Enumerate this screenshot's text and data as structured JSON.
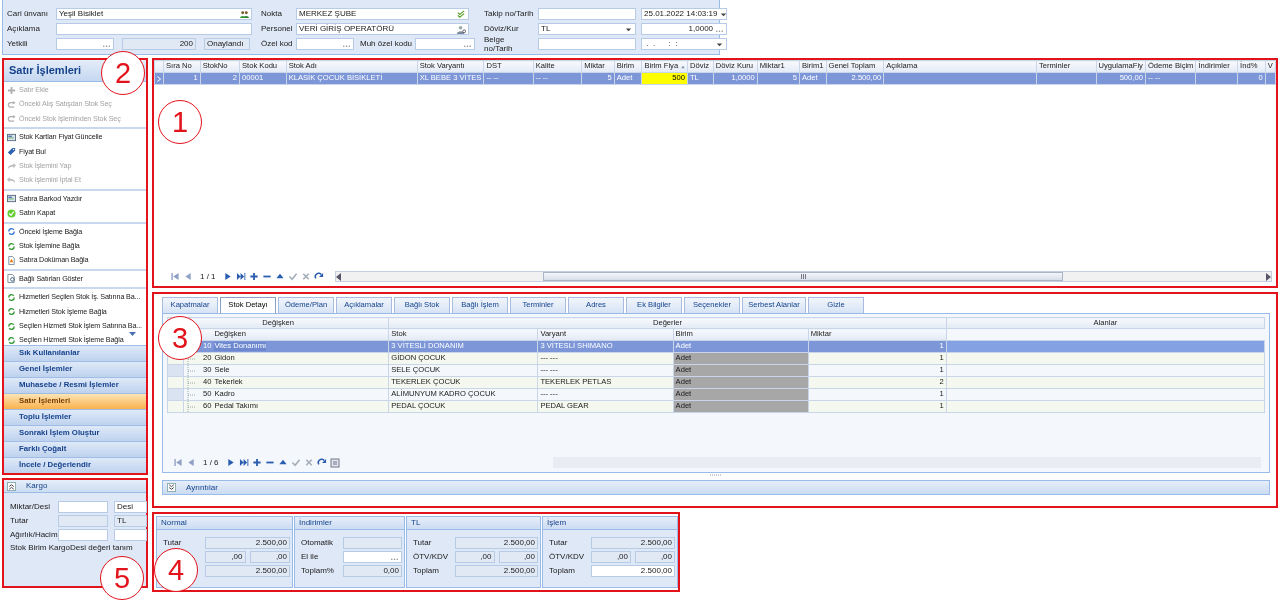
{
  "header": {
    "groups": [
      {
        "rows": [
          {
            "label": "Cari ünvanı",
            "fields": [
              {
                "kind": "icon",
                "value": "Yeşil Bisiklet"
              }
            ]
          },
          {
            "label": "Açıklama",
            "fields": [
              {
                "kind": "text"
              }
            ]
          },
          {
            "label": "Yetkili",
            "fields": [
              {
                "kind": "lookup"
              },
              {
                "kind": "number",
                "value": "200"
              },
              {
                "kind": "readonly",
                "value": "Onaylandı"
              }
            ]
          }
        ]
      },
      {
        "rows": [
          {
            "label": "Nokta",
            "fields": [
              {
                "kind": "icon",
                "value": "MERKEZ ŞUBE"
              }
            ]
          },
          {
            "label": "Personel",
            "fields": [
              {
                "kind": "icon",
                "value": "VERİ GİRİŞ OPERATÖRÜ"
              }
            ]
          },
          {
            "label": "Özel kod",
            "fields": [
              {
                "kind": "lookup"
              },
              {
                "kind": "label",
                "value": "Muh özel kodu"
              },
              {
                "kind": "lookup"
              }
            ]
          }
        ]
      },
      {
        "rows": [
          {
            "label": "Takip no/Tarih",
            "fields": [
              {
                "kind": "text"
              },
              {
                "kind": "dropdown",
                "value": "25.01.2022 14:03:19"
              }
            ]
          },
          {
            "label": "Döviz/Kur",
            "fields": [
              {
                "kind": "dropdown",
                "value": "TL"
              },
              {
                "kind": "number-lookup",
                "value": "1,0000"
              }
            ]
          },
          {
            "label": "Belge no/Tarih",
            "fields": [
              {
                "kind": "text"
              },
              {
                "kind": "dropdown",
                "value": " .  .      :  :"
              }
            ]
          }
        ]
      }
    ]
  },
  "grid": {
    "columns": [
      {
        "title": "Sıra No"
      },
      {
        "title": "StokNo"
      },
      {
        "title": "Stok Kodu"
      },
      {
        "title": "Stok Adı"
      },
      {
        "title": "Stok Varyantı"
      },
      {
        "title": "DST"
      },
      {
        "title": "Kalite"
      },
      {
        "title": "Miktar"
      },
      {
        "title": "Birim"
      },
      {
        "title": "Birim Fiya",
        "sorted": true
      },
      {
        "title": "Döviz"
      },
      {
        "title": "Döviz Kuru"
      },
      {
        "title": "Miktar1"
      },
      {
        "title": "Birim1"
      },
      {
        "title": "Genel Toplam"
      },
      {
        "title": "Açıklama"
      },
      {
        "title": "Terminler"
      },
      {
        "title": "UygulamaFiy"
      },
      {
        "title": "Ödeme Biçim"
      },
      {
        "title": "İndirimler"
      },
      {
        "title": "İnd%"
      },
      {
        "title": "V"
      }
    ],
    "rows": [
      {
        "selected": true,
        "cells": [
          {
            "text": "1"
          },
          {
            "text": "2"
          },
          {
            "text": "00001"
          },
          {
            "text": "KLASİK ÇOCUK BİSİKLETİ"
          },
          {
            "text": "XL BEBE 3 VİTES"
          },
          {
            "text": "-- --"
          },
          {
            "text": "-- --"
          },
          {
            "text": "5"
          },
          {
            "text": "Adet"
          },
          {
            "text": "500",
            "editing": true
          },
          {
            "text": "TL"
          },
          {
            "text": "1,0000"
          },
          {
            "text": "5"
          },
          {
            "text": "Adet"
          },
          {
            "text": "2.500,00"
          },
          {},
          {},
          {
            "text": "500,00"
          },
          {
            "text": "-- --"
          },
          {},
          {
            "text": "0"
          },
          {}
        ]
      }
    ],
    "pager": "1 / 1"
  },
  "actions": {
    "title": "Satır İşlemleri",
    "groups": [
      {
        "items": [
          {
            "label": "Satır Ekle",
            "disabled": true
          },
          {
            "label": "Önceki Alış Satışdan Stok Seç",
            "disabled": true
          },
          {
            "label": "Önceki Stok İşleminden Stok Seç",
            "disabled": true
          }
        ]
      },
      {
        "items": [
          {
            "label": "Stok Kartları Fiyat Güncelle",
            "disabled": false
          },
          {
            "label": "Fiyat Bul",
            "disabled": false
          },
          {
            "label": "Stok İşlemini Yap",
            "disabled": true
          },
          {
            "label": "Stok İşlemini İptal Et",
            "disabled": true
          }
        ]
      },
      {
        "items": [
          {
            "label": "Satıra Barkod Yazdır",
            "disabled": false
          },
          {
            "label": "Satırı Kapat",
            "disabled": false
          }
        ]
      },
      {
        "items": [
          {
            "label": "Önceki İşleme Bağla",
            "disabled": false
          },
          {
            "label": "Stok İşlemine Bağla",
            "disabled": false
          },
          {
            "label": "Satıra Doküman Bağla",
            "disabled": false
          }
        ]
      },
      {
        "items": [
          {
            "label": "Bağlı Satırları Göster",
            "disabled": false
          }
        ]
      },
      {
        "items": [
          {
            "label": "Hizmetleri Seçilen Stok İş. Satırına Ba...",
            "disabled": false
          },
          {
            "label": "Hizmetleri Stok İşleme Bağla",
            "disabled": false
          },
          {
            "label": "Seçilen Hizmeti Stok İşlem Satırına Ba...",
            "disabled": false
          },
          {
            "label": "Seçilen Hizmeti Stok İşleme Bağla",
            "disabled": false
          }
        ]
      }
    ],
    "sections": [
      {
        "label": "Sık Kullanılanlar",
        "selected": false
      },
      {
        "label": "Genel İşlemler",
        "selected": false
      },
      {
        "label": "Muhasebe / Resmi İşlemler",
        "selected": false
      },
      {
        "label": "Satır İşlemleri",
        "selected": true
      },
      {
        "label": "Toplu İşlemler",
        "selected": false
      },
      {
        "label": "Sonraki İşlem Oluştur",
        "selected": false
      },
      {
        "label": "Farklı Çoğalt",
        "selected": false
      },
      {
        "label": "İncele / Değerlendir",
        "selected": false
      }
    ]
  },
  "cargo": {
    "title": "Kargo",
    "expanded": true,
    "rows": [
      {
        "label": "Miktar/Desi",
        "fields": [
          {
            "kind": "text"
          },
          {
            "kind": "text",
            "value": "Desi"
          }
        ]
      },
      {
        "label": "Tutar",
        "fields": [
          {
            "kind": "readonly"
          },
          {
            "kind": "readonly",
            "value": "TL"
          }
        ]
      },
      {
        "label": "Ağırlık/Hacim",
        "fields": [
          {
            "kind": "text"
          },
          {
            "kind": "text"
          }
        ]
      }
    ],
    "note": "Stok Birim KargoDesi değeri tanım"
  },
  "tabs": [
    {
      "label": "Kapatmalar",
      "selected": false
    },
    {
      "label": "Stok Detayı",
      "selected": true
    },
    {
      "label": "Ödeme/Plan",
      "selected": false
    },
    {
      "label": "Açıklamalar",
      "selected": false
    },
    {
      "label": "Bağlı Stok",
      "selected": false
    },
    {
      "label": "Bağlı İşlem",
      "selected": false
    },
    {
      "label": "Terminler",
      "selected": false
    },
    {
      "label": "Adres",
      "selected": false
    },
    {
      "label": "Ek Bilgiler",
      "selected": false
    },
    {
      "label": "Seçenekler",
      "selected": false
    },
    {
      "label": "Serbest Alanlar",
      "selected": false
    },
    {
      "label": "Gizle",
      "selected": false
    }
  ],
  "detail": {
    "bands": [
      "Değişken",
      "Değerler",
      "Alanlar"
    ],
    "columns": [
      "Değişken",
      "Stok",
      "Varyant",
      "Birim",
      "Miktar"
    ],
    "rows": [
      {
        "code": "10",
        "name": "Vites Donanımı",
        "stok": "3 VİTESLİ DONANIM",
        "varyant": "3 VİTESLİ SHIMANO",
        "birim": "Adet",
        "miktar": "1",
        "selected": true
      },
      {
        "code": "20",
        "name": "Gidon",
        "stok": "GİDON ÇOCUK",
        "varyant": "--- ---",
        "birim": "Adet",
        "miktar": "1",
        "selected": false
      },
      {
        "code": "30",
        "name": "Sele",
        "stok": "SELE ÇOCUK",
        "varyant": "--- ---",
        "birim": "Adet",
        "miktar": "1",
        "selected": false
      },
      {
        "code": "40",
        "name": "Tekerlek",
        "stok": "TEKERLEK ÇOCUK",
        "varyant": "TEKERLEK PETLAS",
        "birim": "Adet",
        "miktar": "2",
        "selected": false
      },
      {
        "code": "50",
        "name": "Kadro",
        "stok": "ALİMUNYUM KADRO ÇOCUK",
        "varyant": "--- ---",
        "birim": "Adet",
        "miktar": "1",
        "selected": false
      },
      {
        "code": "60",
        "name": "Pedal Takımı",
        "stok": "PEDAL ÇOCUK",
        "varyant": "PEDAL GEAR",
        "birim": "Adet",
        "miktar": "1",
        "selected": false
      }
    ],
    "pager": "1 / 6",
    "details_bar": {
      "label": "Ayrıntılar",
      "expanded": false
    }
  },
  "totals": [
    {
      "title": "Normal",
      "rows": [
        {
          "label": "Tutar",
          "values": [
            {
              "text": "2.500,00",
              "kind": "readonly"
            }
          ]
        },
        {
          "values": [
            {
              "text": ",00",
              "kind": "readonly"
            },
            {
              "text": ",00",
              "kind": "readonly"
            }
          ]
        },
        {
          "values": [
            {
              "text": "2.500,00",
              "kind": "readonly"
            }
          ]
        }
      ]
    },
    {
      "title": "İndirimler",
      "rows": [
        {
          "label": "Otomatik",
          "values": [
            {
              "kind": "readonly"
            }
          ]
        },
        {
          "label": "El ile",
          "values": [
            {
              "kind": "lookup"
            }
          ]
        },
        {
          "label": "Toplam%",
          "values": [
            {
              "text": "0,00",
              "kind": "readonly"
            }
          ]
        }
      ]
    },
    {
      "title": "TL",
      "rows": [
        {
          "label": "Tutar",
          "values": [
            {
              "text": "2.500,00",
              "kind": "readonly"
            }
          ]
        },
        {
          "label": "ÖTV/KDV",
          "values": [
            {
              "text": ",00",
              "kind": "readonly"
            },
            {
              "text": ",00",
              "kind": "readonly"
            }
          ]
        },
        {
          "label": "Toplam",
          "values": [
            {
              "text": "2.500,00",
              "kind": "readonly"
            }
          ]
        }
      ]
    },
    {
      "title": "İşlem",
      "rows": [
        {
          "label": "Tutar",
          "values": [
            {
              "text": "2.500,00",
              "kind": "readonly"
            }
          ]
        },
        {
          "label": "ÖTV/KDV",
          "values": [
            {
              "text": ",00",
              "kind": "readonly"
            },
            {
              "text": ",00",
              "kind": "readonly"
            }
          ]
        },
        {
          "label": "Toplam",
          "values": [
            {
              "text": "2.500,00",
              "kind": "input"
            }
          ]
        }
      ]
    }
  ],
  "annotations": [
    {
      "number": "2"
    },
    {
      "number": "1"
    },
    {
      "number": "3"
    },
    {
      "number": "5"
    },
    {
      "number": "4"
    }
  ]
}
